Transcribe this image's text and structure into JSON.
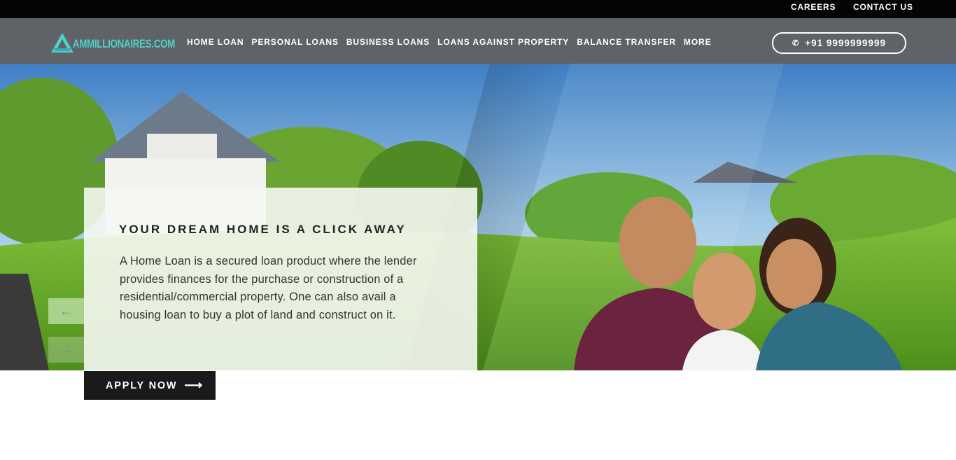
{
  "topbar": {
    "careers": "CAREERS",
    "contact": "CONTACT US"
  },
  "brand": {
    "name": "AMMILLIONAIRES.COM",
    "color": "#4fd0c8"
  },
  "nav": {
    "items": [
      "HOME LOAN",
      "PERSONAL LOANS",
      "BUSINESS LOANS",
      "LOANS AGAINST PROPERTY",
      "BALANCE TRANSFER",
      "MORE"
    ],
    "phone": "+91 9999999999",
    "phone_icon": "phone-icon"
  },
  "hero": {
    "title": "YOUR DREAM HOME IS A CLICK AWAY",
    "description": "A Home Loan is a secured loan product where the lender provides finances for the purchase or construction of a residential/commercial property. One can also avail a housing loan to buy a plot of land and construct on it.",
    "prev_icon": "←",
    "next_icon": "→",
    "cta": "APPLY NOW",
    "cta_icon": "⟶"
  },
  "colors": {
    "topbar": "#050505",
    "navbar": "#5f6266",
    "accent": "#3b9bc0"
  }
}
